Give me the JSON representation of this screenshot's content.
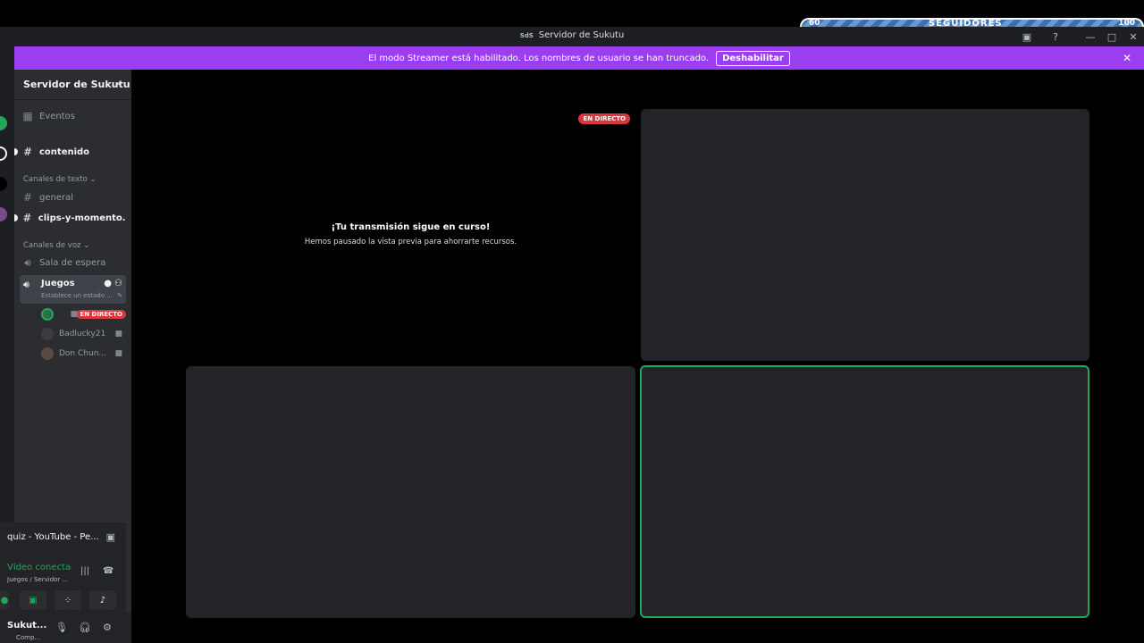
{
  "window": {
    "title": "Servidor de Sukutu",
    "server_abbrev": "SdS"
  },
  "banner": {
    "message": "El modo Streamer está habilitado. Los nombres de usuario se han truncado.",
    "button": "Deshabilitar"
  },
  "overlay": {
    "left": "60",
    "middle": "SEGUIDORES",
    "right": "100"
  },
  "sidebar": {
    "server_name": "Servidor de Sukutu",
    "events": "Eventos",
    "channel_contenido": "contenido",
    "text_category": "Canales de texto",
    "text_channels": [
      "general",
      "clips-y-momento..."
    ],
    "voice_category": "Canales de voz",
    "voice_waiting": "Sala de espera",
    "voice_active": {
      "name": "Juegos",
      "status": "Establece un estado ...",
      "live_label": "EN DIRECTO",
      "users": [
        "Badlucky21",
        "Don Chun..."
      ]
    }
  },
  "activity": {
    "text": "quiz - YouTube - Pe..."
  },
  "voice_panel": {
    "status": "Vídeo conectad",
    "location": "Juegos / Servidor ..."
  },
  "user_panel": {
    "name": "Sukut...",
    "status": "Comp..."
  },
  "stage": {
    "live_label": "EN DIRECTO",
    "paused_title": "¡Tu transmisión sigue en curso!",
    "paused_text": "Hemos pausado la vista previa para ahorrarte recursos."
  },
  "colors": {
    "banner": "#9b3ef0",
    "live": "#da373c",
    "speaking_outline": "#23a55a"
  }
}
